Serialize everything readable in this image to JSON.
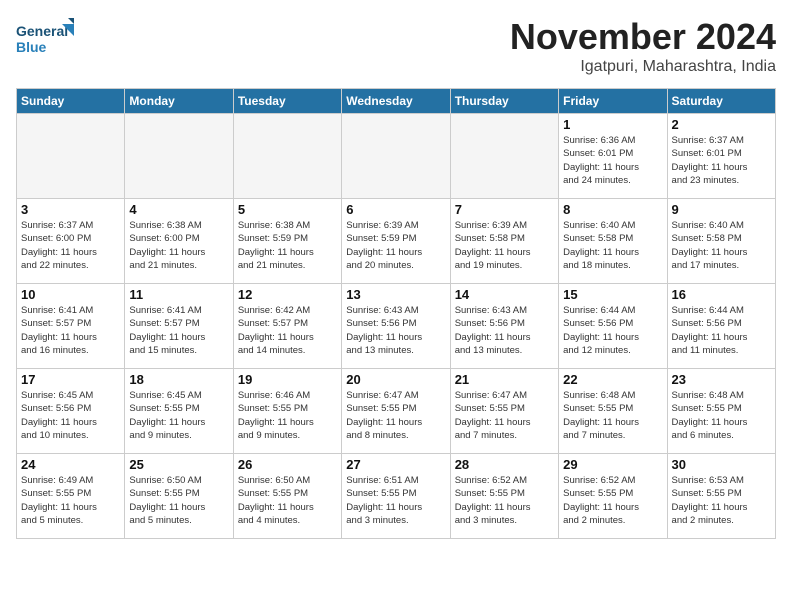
{
  "header": {
    "logo_line1": "General",
    "logo_line2": "Blue",
    "month": "November 2024",
    "location": "Igatpuri, Maharashtra, India"
  },
  "days_of_week": [
    "Sunday",
    "Monday",
    "Tuesday",
    "Wednesday",
    "Thursday",
    "Friday",
    "Saturday"
  ],
  "weeks": [
    [
      {
        "day": "",
        "info": ""
      },
      {
        "day": "",
        "info": ""
      },
      {
        "day": "",
        "info": ""
      },
      {
        "day": "",
        "info": ""
      },
      {
        "day": "",
        "info": ""
      },
      {
        "day": "1",
        "info": "Sunrise: 6:36 AM\nSunset: 6:01 PM\nDaylight: 11 hours\nand 24 minutes."
      },
      {
        "day": "2",
        "info": "Sunrise: 6:37 AM\nSunset: 6:01 PM\nDaylight: 11 hours\nand 23 minutes."
      }
    ],
    [
      {
        "day": "3",
        "info": "Sunrise: 6:37 AM\nSunset: 6:00 PM\nDaylight: 11 hours\nand 22 minutes."
      },
      {
        "day": "4",
        "info": "Sunrise: 6:38 AM\nSunset: 6:00 PM\nDaylight: 11 hours\nand 21 minutes."
      },
      {
        "day": "5",
        "info": "Sunrise: 6:38 AM\nSunset: 5:59 PM\nDaylight: 11 hours\nand 21 minutes."
      },
      {
        "day": "6",
        "info": "Sunrise: 6:39 AM\nSunset: 5:59 PM\nDaylight: 11 hours\nand 20 minutes."
      },
      {
        "day": "7",
        "info": "Sunrise: 6:39 AM\nSunset: 5:58 PM\nDaylight: 11 hours\nand 19 minutes."
      },
      {
        "day": "8",
        "info": "Sunrise: 6:40 AM\nSunset: 5:58 PM\nDaylight: 11 hours\nand 18 minutes."
      },
      {
        "day": "9",
        "info": "Sunrise: 6:40 AM\nSunset: 5:58 PM\nDaylight: 11 hours\nand 17 minutes."
      }
    ],
    [
      {
        "day": "10",
        "info": "Sunrise: 6:41 AM\nSunset: 5:57 PM\nDaylight: 11 hours\nand 16 minutes."
      },
      {
        "day": "11",
        "info": "Sunrise: 6:41 AM\nSunset: 5:57 PM\nDaylight: 11 hours\nand 15 minutes."
      },
      {
        "day": "12",
        "info": "Sunrise: 6:42 AM\nSunset: 5:57 PM\nDaylight: 11 hours\nand 14 minutes."
      },
      {
        "day": "13",
        "info": "Sunrise: 6:43 AM\nSunset: 5:56 PM\nDaylight: 11 hours\nand 13 minutes."
      },
      {
        "day": "14",
        "info": "Sunrise: 6:43 AM\nSunset: 5:56 PM\nDaylight: 11 hours\nand 13 minutes."
      },
      {
        "day": "15",
        "info": "Sunrise: 6:44 AM\nSunset: 5:56 PM\nDaylight: 11 hours\nand 12 minutes."
      },
      {
        "day": "16",
        "info": "Sunrise: 6:44 AM\nSunset: 5:56 PM\nDaylight: 11 hours\nand 11 minutes."
      }
    ],
    [
      {
        "day": "17",
        "info": "Sunrise: 6:45 AM\nSunset: 5:56 PM\nDaylight: 11 hours\nand 10 minutes."
      },
      {
        "day": "18",
        "info": "Sunrise: 6:45 AM\nSunset: 5:55 PM\nDaylight: 11 hours\nand 9 minutes."
      },
      {
        "day": "19",
        "info": "Sunrise: 6:46 AM\nSunset: 5:55 PM\nDaylight: 11 hours\nand 9 minutes."
      },
      {
        "day": "20",
        "info": "Sunrise: 6:47 AM\nSunset: 5:55 PM\nDaylight: 11 hours\nand 8 minutes."
      },
      {
        "day": "21",
        "info": "Sunrise: 6:47 AM\nSunset: 5:55 PM\nDaylight: 11 hours\nand 7 minutes."
      },
      {
        "day": "22",
        "info": "Sunrise: 6:48 AM\nSunset: 5:55 PM\nDaylight: 11 hours\nand 7 minutes."
      },
      {
        "day": "23",
        "info": "Sunrise: 6:48 AM\nSunset: 5:55 PM\nDaylight: 11 hours\nand 6 minutes."
      }
    ],
    [
      {
        "day": "24",
        "info": "Sunrise: 6:49 AM\nSunset: 5:55 PM\nDaylight: 11 hours\nand 5 minutes."
      },
      {
        "day": "25",
        "info": "Sunrise: 6:50 AM\nSunset: 5:55 PM\nDaylight: 11 hours\nand 5 minutes."
      },
      {
        "day": "26",
        "info": "Sunrise: 6:50 AM\nSunset: 5:55 PM\nDaylight: 11 hours\nand 4 minutes."
      },
      {
        "day": "27",
        "info": "Sunrise: 6:51 AM\nSunset: 5:55 PM\nDaylight: 11 hours\nand 3 minutes."
      },
      {
        "day": "28",
        "info": "Sunrise: 6:52 AM\nSunset: 5:55 PM\nDaylight: 11 hours\nand 3 minutes."
      },
      {
        "day": "29",
        "info": "Sunrise: 6:52 AM\nSunset: 5:55 PM\nDaylight: 11 hours\nand 2 minutes."
      },
      {
        "day": "30",
        "info": "Sunrise: 6:53 AM\nSunset: 5:55 PM\nDaylight: 11 hours\nand 2 minutes."
      }
    ]
  ]
}
